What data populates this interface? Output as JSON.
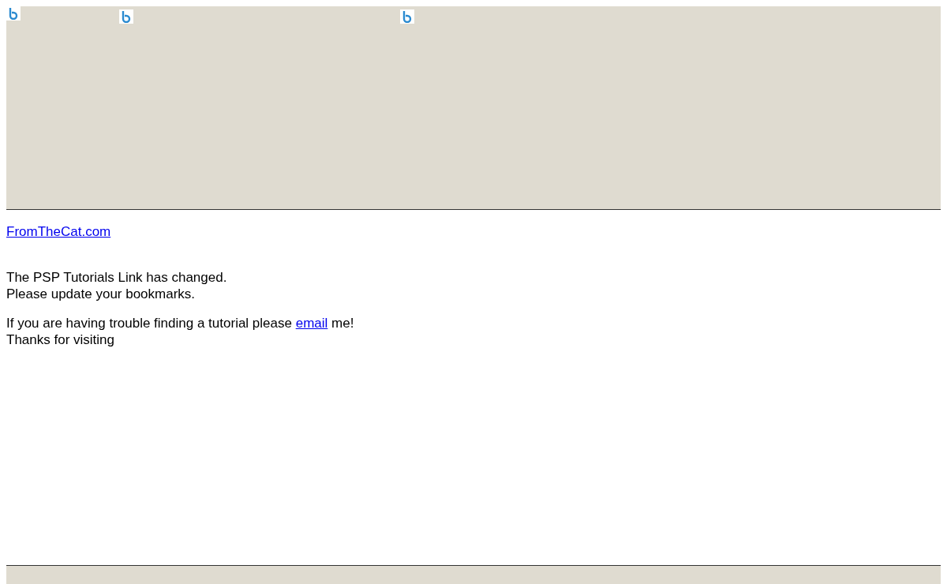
{
  "banner": {
    "images": [
      {
        "kind": "broken"
      },
      {
        "kind": "broken"
      },
      {
        "kind": "broken"
      }
    ]
  },
  "site_link": "FromTheCat.com",
  "notice_lines": [
    "The PSP Tutorials Link has changed.",
    "Please update your bookmarks."
  ],
  "help": {
    "before": "If you are having trouble finding a tutorial please ",
    "link": "email",
    "after": " me!"
  },
  "closing": "Thanks for visiting"
}
